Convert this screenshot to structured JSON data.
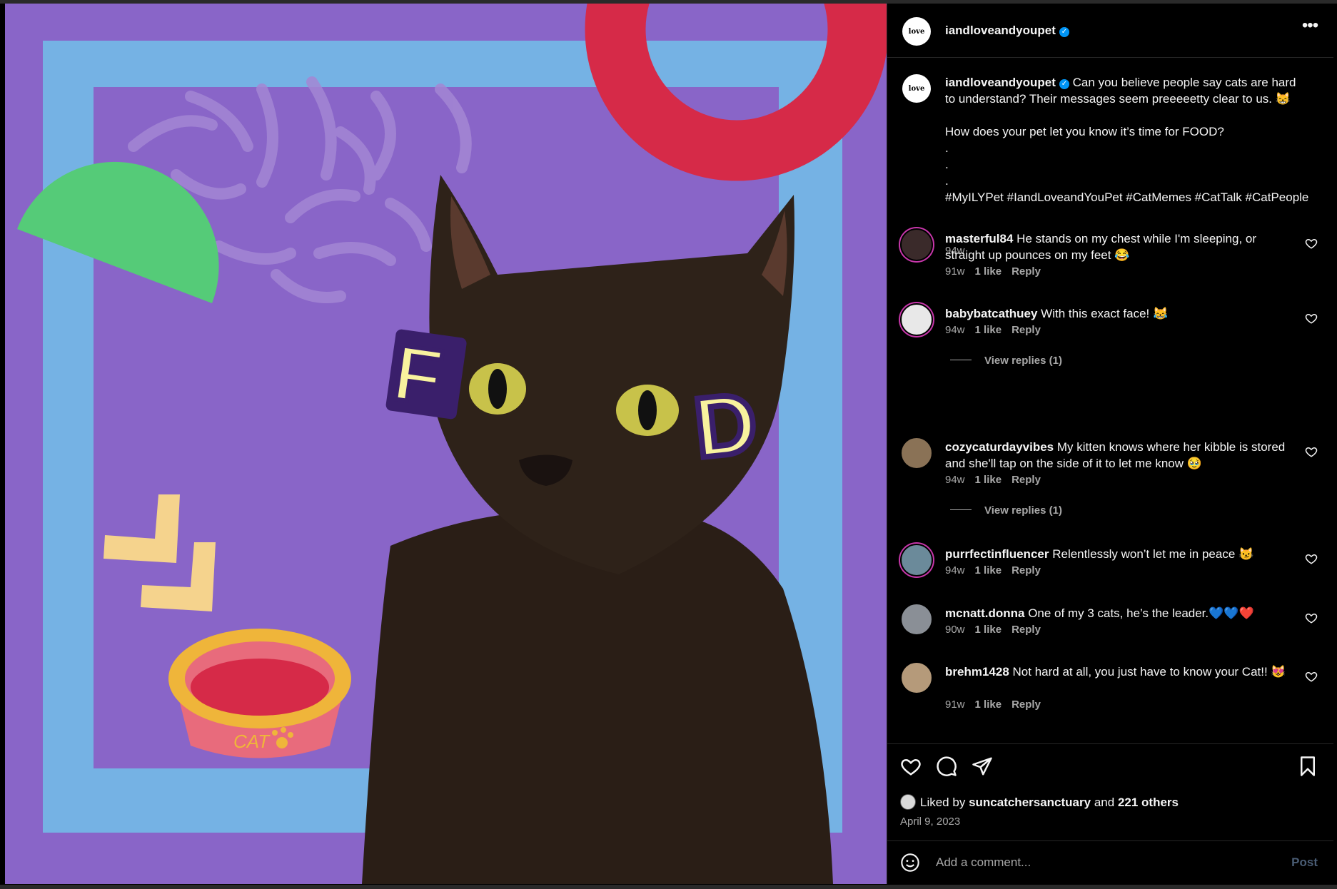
{
  "post": {
    "username": "iandloveandyoupet",
    "verified": true,
    "avatar_text": "\"I and love and you\"",
    "more_options": "•••"
  },
  "media": {
    "letter_left": "F",
    "letter_right": "D",
    "bowl_label": "CAT"
  },
  "caption": {
    "username": "iandloveandyoupet",
    "text": "Can you believe people say cats are hard to understand? Their messages seem preeeeetty clear to us. 😸\n\nHow does your pet let you know it’s time for FOOD?\n.\n.\n.\n#MyILYPet #IandLoveandYouPet #CatMemes #CatTalk #CatPeople",
    "age": "94w"
  },
  "comments": [
    {
      "username": "masterful84",
      "text": "He stands on my chest while I'm sleeping, or straight up pounces on my feet 😂",
      "age": "91w",
      "likes": "1 like",
      "reply": "Reply"
    },
    {
      "username": "babybatcathuey",
      "text": "With this exact face! 😹",
      "age": "94w",
      "likes": "1 like",
      "reply": "Reply",
      "view_replies": "View replies (1)"
    },
    {
      "username": "cozycaturdayvibes",
      "text": "My kitten knows where her kibble is stored and she'll tap on the side of it to let me know 🥹",
      "age": "94w",
      "likes": "1 like",
      "reply": "Reply",
      "view_replies": "View replies (1)"
    },
    {
      "username": "purrfectinfluencer",
      "text": "Relentlessly won’t let me in peace 😼",
      "age": "94w",
      "likes": "1 like",
      "reply": "Reply"
    },
    {
      "username": "mcnatt.donna",
      "text": "One of my 3 cats, he’s the leader.💙💙❤️",
      "age": "90w",
      "likes": "1 like",
      "reply": "Reply"
    },
    {
      "username": "brehm1428",
      "text": "Not hard at all, you just have to know your Cat!! 😻",
      "age": "91w",
      "likes": "1 like",
      "reply": "Reply"
    }
  ],
  "likes": {
    "prefix": "Liked by",
    "user": "suncatchersanctuary",
    "and": "and",
    "others": "221 others"
  },
  "date": "April 9, 2023",
  "add_comment": {
    "placeholder": "Add a comment...",
    "post_label": "Post"
  },
  "colors": {
    "accent": "#0095f6",
    "background": "#000000",
    "media_purple": "#8965c8",
    "media_blue": "#75b2e4",
    "media_red": "#d62a48",
    "media_green": "#55cb78",
    "media_yellow": "#f8f29e"
  },
  "icons": [
    "verified-icon",
    "more-icon",
    "heart-icon",
    "comment-icon",
    "share-icon",
    "bookmark-icon",
    "emoji-icon"
  ]
}
